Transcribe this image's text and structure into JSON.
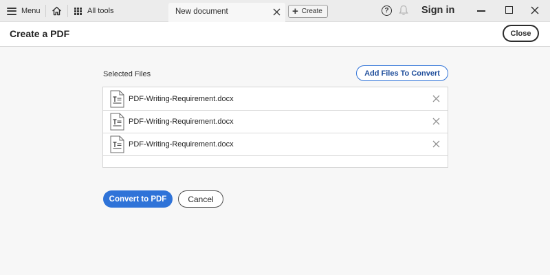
{
  "titlebar": {
    "menu_label": "Menu",
    "home_icon": "home-icon",
    "all_tools_label": "All tools",
    "tab_label": "New document",
    "create_label": "Create",
    "help_icon_glyph": "?",
    "bell_icon": "bell-icon",
    "signin_label": "Sign in",
    "window_controls": [
      "minimize-icon",
      "maximize-icon",
      "close-icon"
    ]
  },
  "header": {
    "title": "Create a PDF",
    "close_label": "Close"
  },
  "main": {
    "selected_label": "Selected Files",
    "add_files_label": "Add Files To Convert",
    "files": [
      {
        "name": "PDF-Writing-Requirement.docx",
        "icon": "document-text-icon"
      },
      {
        "name": "PDF-Writing-Requirement.docx",
        "icon": "document-text-icon"
      },
      {
        "name": "PDF-Writing-Requirement.docx",
        "icon": "document-text-icon"
      }
    ],
    "convert_label": "Convert to PDF",
    "cancel_label": "Cancel"
  },
  "colors": {
    "accent": "#2f73d8",
    "accent_text": "#1d4c9a",
    "titlebar_bg": "#ececec",
    "page_bg": "#f7f7f7"
  }
}
